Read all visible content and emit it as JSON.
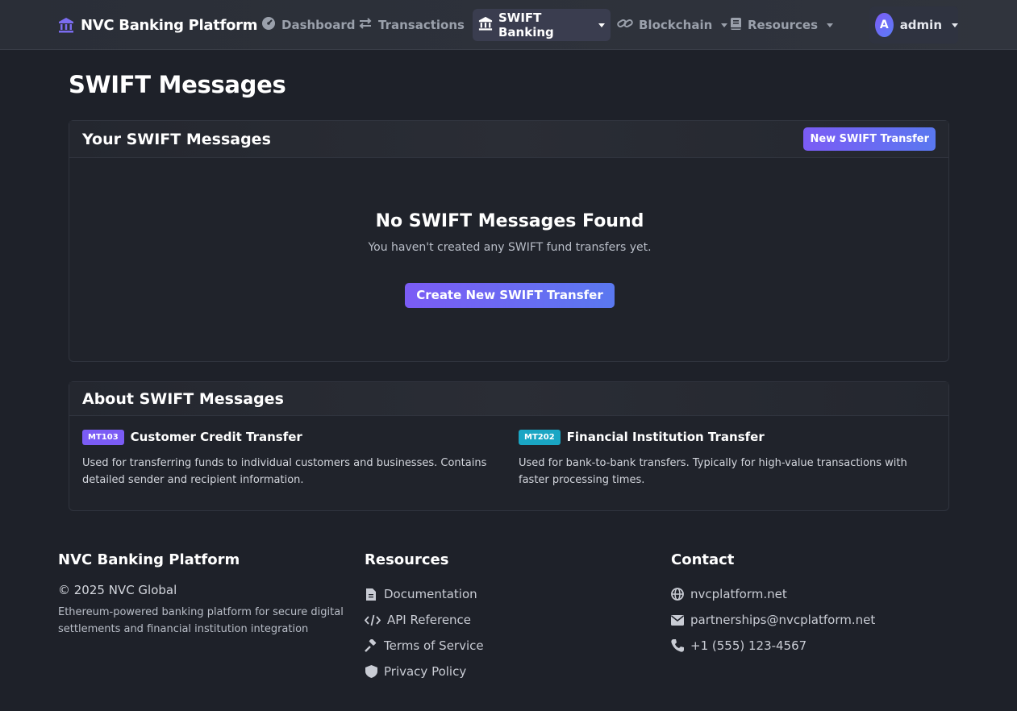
{
  "navbar": {
    "brand": "NVC Banking Platform",
    "items": [
      {
        "label": "Dashboard",
        "icon": "dashboard-gauge-icon",
        "dropdown": false,
        "active": false
      },
      {
        "label": "Transactions",
        "icon": "exchange-arrows-icon",
        "dropdown": true,
        "active": false
      },
      {
        "label": "SWIFT Banking",
        "icon": "bank-icon",
        "dropdown": true,
        "active": true
      },
      {
        "label": "Blockchain",
        "icon": "link-icon",
        "dropdown": true,
        "active": false
      },
      {
        "label": "Resources",
        "icon": "book-icon",
        "dropdown": true,
        "active": false
      }
    ],
    "user": {
      "initial": "A",
      "name": "admin"
    }
  },
  "page": {
    "title": "SWIFT Messages"
  },
  "messages_card": {
    "title": "Your SWIFT Messages",
    "new_button": "New SWIFT Transfer",
    "empty_title": "No SWIFT Messages Found",
    "empty_subtitle": "You haven't created any SWIFT fund transfers yet.",
    "create_button": "Create New SWIFT Transfer"
  },
  "about_card": {
    "title": "About SWIFT Messages",
    "types": [
      {
        "badge": "MT103",
        "badge_color": "#7b5cf5",
        "title": "Customer Credit Transfer",
        "description": "Used for transferring funds to individual customers and businesses. Contains detailed sender and recipient information."
      },
      {
        "badge": "MT202",
        "badge_color": "#1aa6c4",
        "title": "Financial Institution Transfer",
        "description": "Used for bank-to-bank transfers. Typically for high-value transactions with faster processing times."
      }
    ]
  },
  "footer": {
    "about": {
      "title": "NVC Banking Platform",
      "copyright": "© 2025 NVC Global",
      "description": "Ethereum-powered banking platform for secure digital settlements and financial institution integration"
    },
    "resources": {
      "title": "Resources",
      "links": [
        {
          "label": "Documentation",
          "icon": "file-icon"
        },
        {
          "label": "API Reference",
          "icon": "code-icon"
        },
        {
          "label": "Terms of Service",
          "icon": "gavel-icon"
        },
        {
          "label": "Privacy Policy",
          "icon": "shield-icon"
        }
      ]
    },
    "contact": {
      "title": "Contact",
      "links": [
        {
          "label": "nvcplatform.net",
          "icon": "globe-icon"
        },
        {
          "label": "partnerships@nvcplatform.net",
          "icon": "envelope-icon"
        },
        {
          "label": "+1 (555) 123-4567",
          "icon": "phone-icon"
        }
      ]
    }
  },
  "colors": {
    "accent": "#7b5cf5",
    "accent_2": "#5a78f0",
    "background": "#1e2129",
    "teal": "#1aa6c4"
  }
}
